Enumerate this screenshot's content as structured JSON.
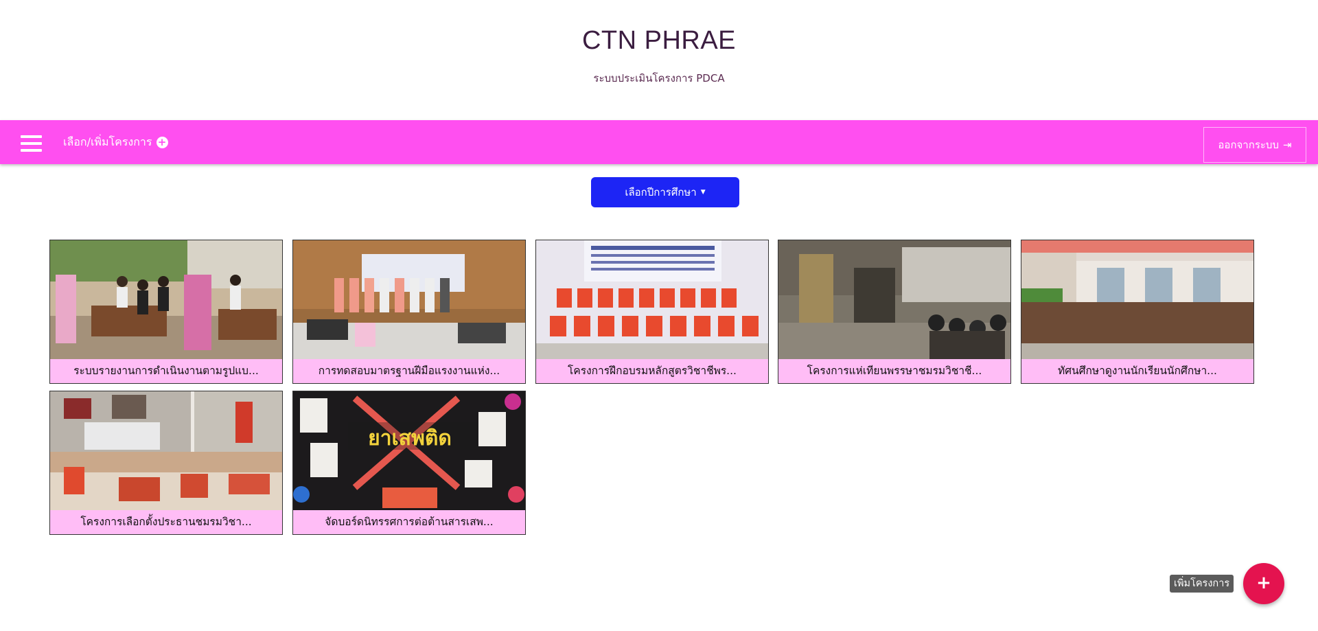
{
  "header": {
    "title": "CTN PHRAE",
    "subtitle": "ระบบประเมินโครงการ PDCA"
  },
  "navbar": {
    "menu_icon": "hamburger-menu-icon",
    "project_label": "เลือก/เพิ่มโครงการ",
    "project_icon": "plus-circle-icon",
    "logout_label": "ออกจากระบบ",
    "logout_icon": "sign-out-icon",
    "color": "#ff4ff0"
  },
  "year_dropdown": {
    "label": "เลือกปีการศึกษา",
    "color": "#1d25f5"
  },
  "projects": [
    {
      "caption": "ระบบรายงานการดำเนินงานตามรูปแบ..."
    },
    {
      "caption": "การทดสอบมาตรฐานฝีมือแรงงานแห่ง..."
    },
    {
      "caption": "โครงการฝึกอบรมหลักสูตรวิชาชีพร..."
    },
    {
      "caption": "โครงการแห่เทียนพรรษาชมรมวิชาชี..."
    },
    {
      "caption": "ทัศนศึกษาดูงานนักเรียนนักศึกษา..."
    },
    {
      "caption": "โครงการเลือกตั้งประธานชมรมวิชา..."
    },
    {
      "caption": "จัดบอร์ดนิทรรศการต่อต้านสารเสพ..."
    }
  ],
  "fab": {
    "label": "เพิ่มโครงการ",
    "icon": "plus-icon",
    "color": "#e4134f"
  }
}
